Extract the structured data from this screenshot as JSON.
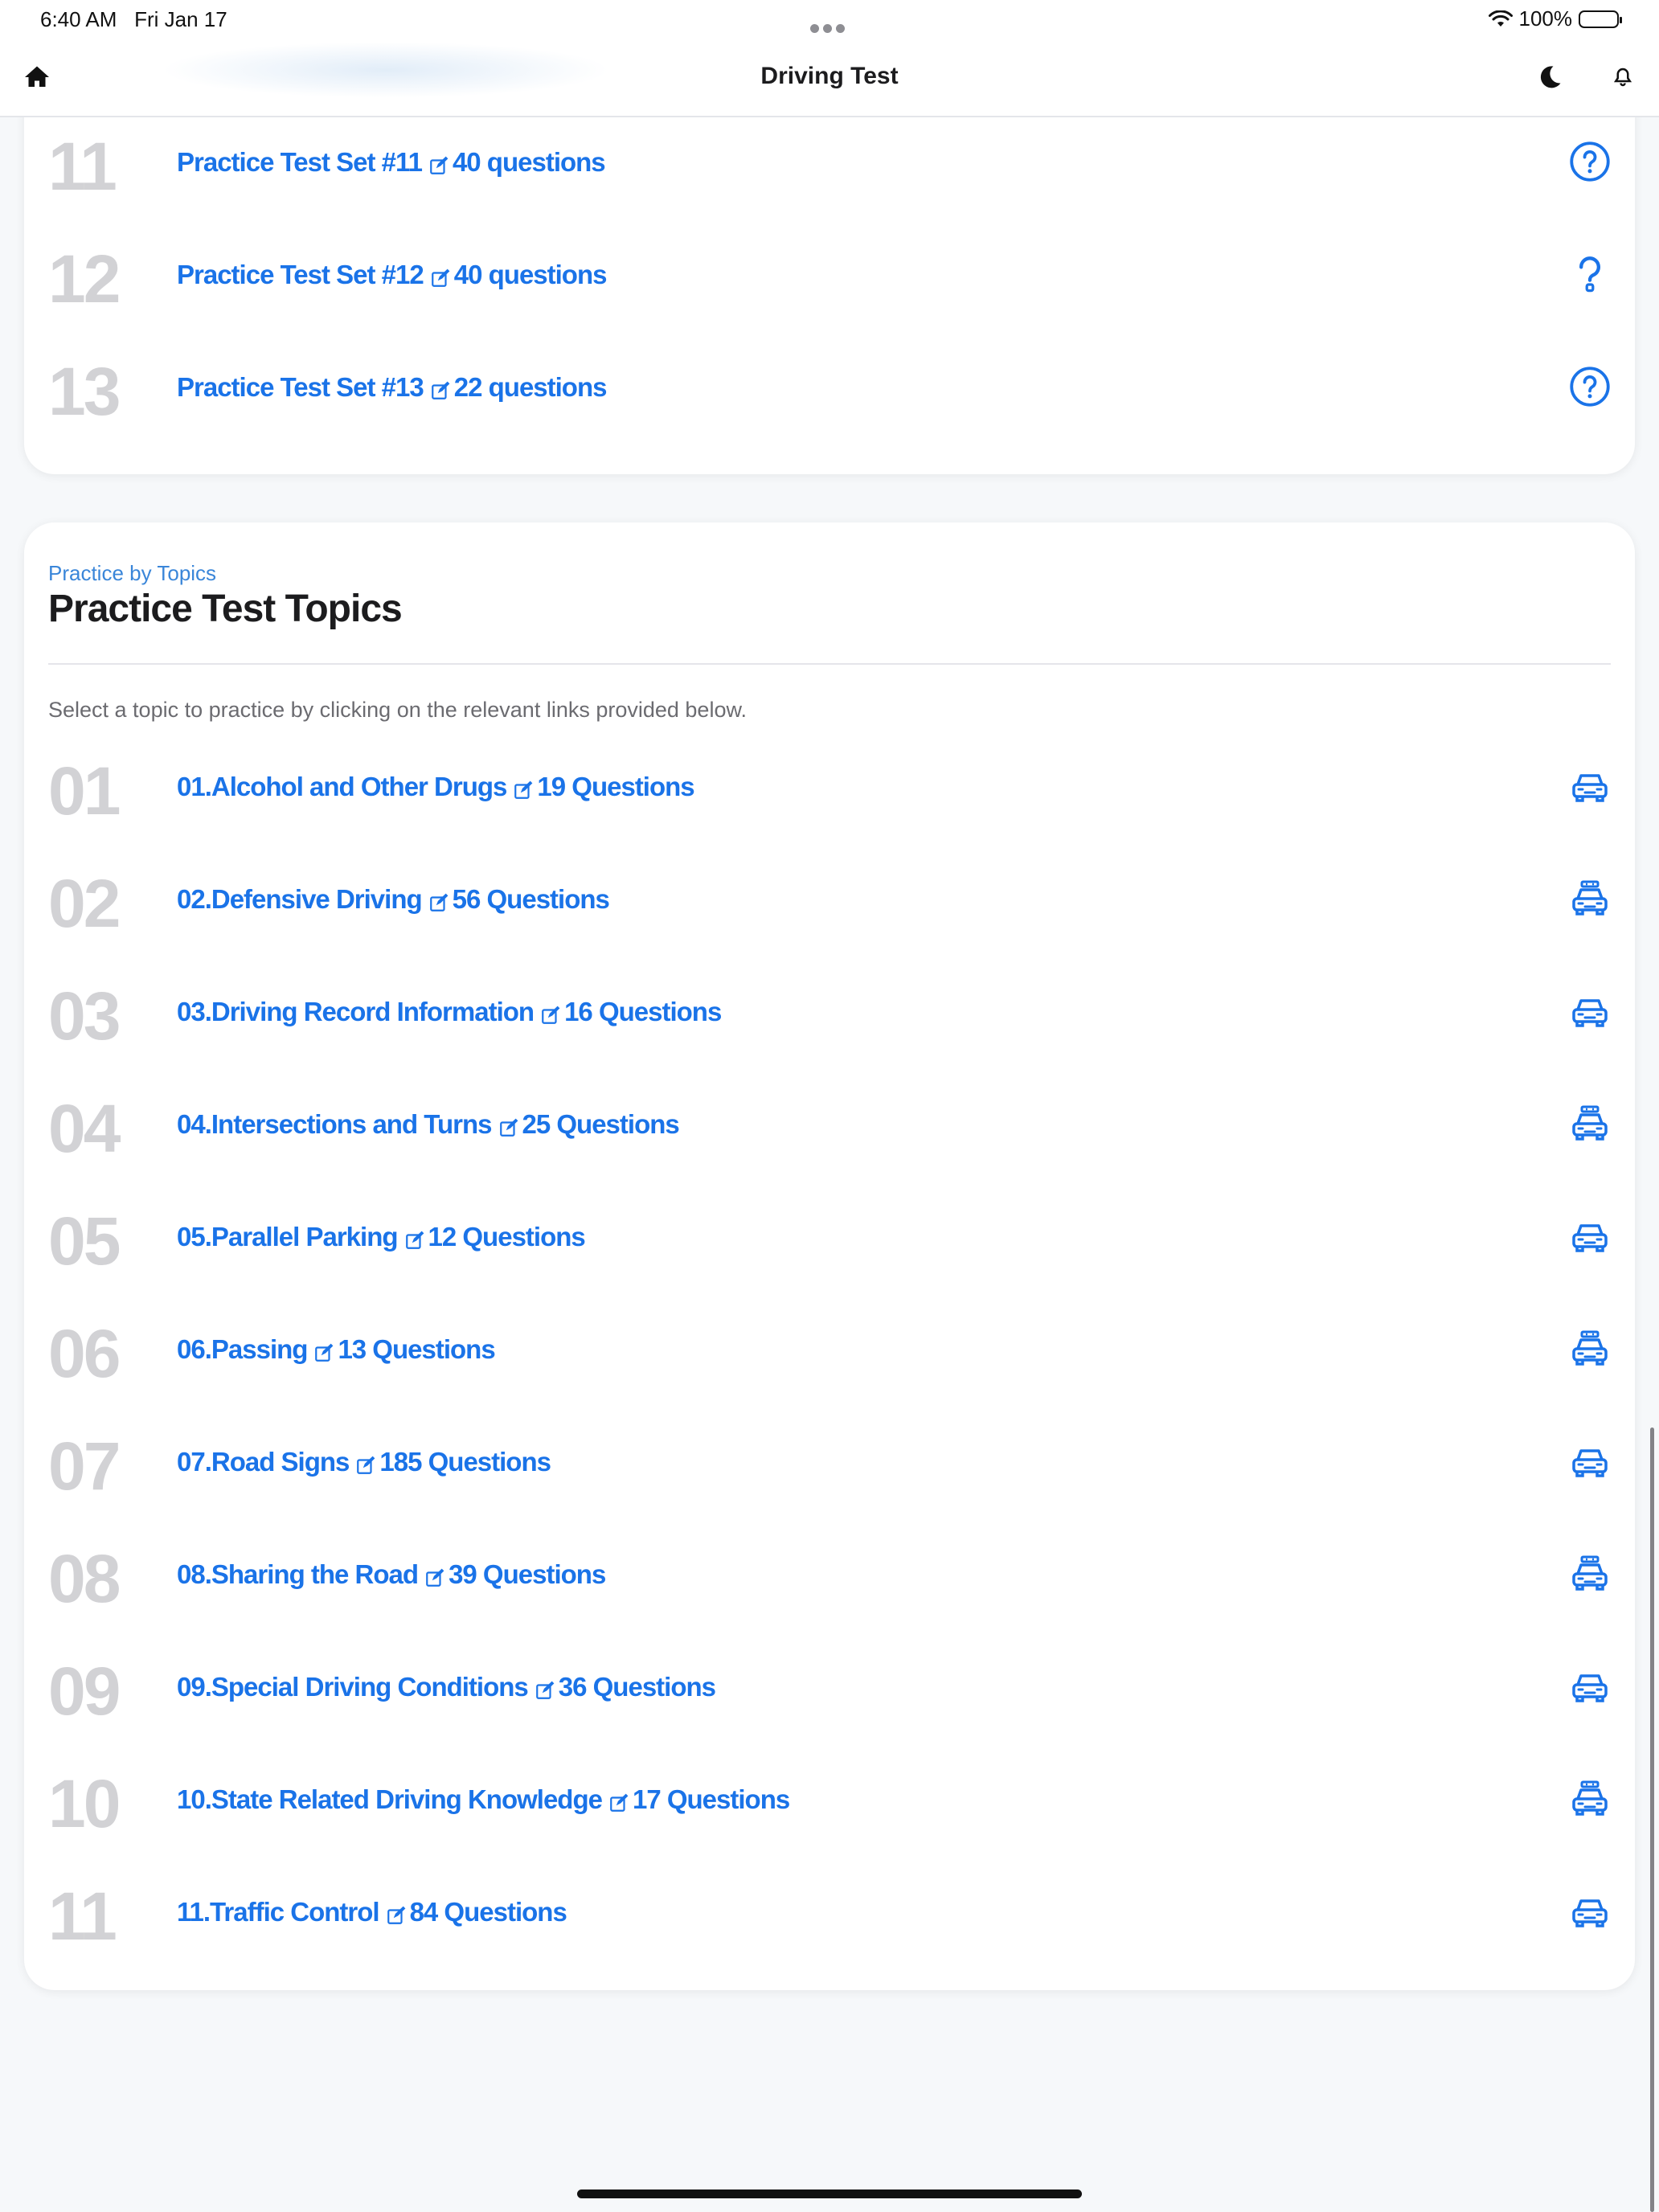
{
  "status_bar": {
    "time": "6:40 AM",
    "date": "Fri Jan 17",
    "battery": "100%"
  },
  "navbar": {
    "title": "Driving Test",
    "icons": [
      "home-icon",
      "moon-icon",
      "bell-icon"
    ]
  },
  "practice_sets": [
    {
      "number": "11",
      "title": "Practice Test Set #11",
      "count": "40 questions",
      "icon": "question-circle-icon"
    },
    {
      "number": "12",
      "title": "Practice Test Set #12",
      "count": "40 questions",
      "icon": "question-mark-icon"
    },
    {
      "number": "13",
      "title": "Practice Test Set #13",
      "count": "22 questions",
      "icon": "question-circle-icon"
    }
  ],
  "topics_section": {
    "eyebrow": "Practice by Topics",
    "heading": "Practice Test Topics",
    "intro": "Select a topic to practice by clicking on the relevant links provided below.",
    "items": [
      {
        "number": "01",
        "title": "01.Alcohol and Other Drugs",
        "count": "19 Questions",
        "icon": "car-icon"
      },
      {
        "number": "02",
        "title": "02.Defensive Driving",
        "count": "56 Questions",
        "icon": "taxi-icon"
      },
      {
        "number": "03",
        "title": "03.Driving Record Information",
        "count": "16 Questions",
        "icon": "car-icon"
      },
      {
        "number": "04",
        "title": "04.Intersections and Turns",
        "count": "25 Questions",
        "icon": "taxi-icon"
      },
      {
        "number": "05",
        "title": "05.Parallel Parking",
        "count": "12 Questions",
        "icon": "car-icon"
      },
      {
        "number": "06",
        "title": "06.Passing",
        "count": "13 Questions",
        "icon": "taxi-icon"
      },
      {
        "number": "07",
        "title": "07.Road Signs",
        "count": "185 Questions",
        "icon": "car-icon"
      },
      {
        "number": "08",
        "title": "08.Sharing the Road",
        "count": "39 Questions",
        "icon": "taxi-icon"
      },
      {
        "number": "09",
        "title": "09.Special Driving Conditions",
        "count": "36 Questions",
        "icon": "car-icon"
      },
      {
        "number": "10",
        "title": "10.State Related Driving Knowledge",
        "count": "17 Questions",
        "icon": "taxi-icon"
      },
      {
        "number": "11",
        "title": "11.Traffic Control",
        "count": "84 Questions",
        "icon": "car-icon"
      }
    ]
  },
  "colors": {
    "link": "#1a73e8",
    "number": "#d2d2d5",
    "eyebrow": "#3a86d9",
    "background": "#f6f8fa"
  }
}
